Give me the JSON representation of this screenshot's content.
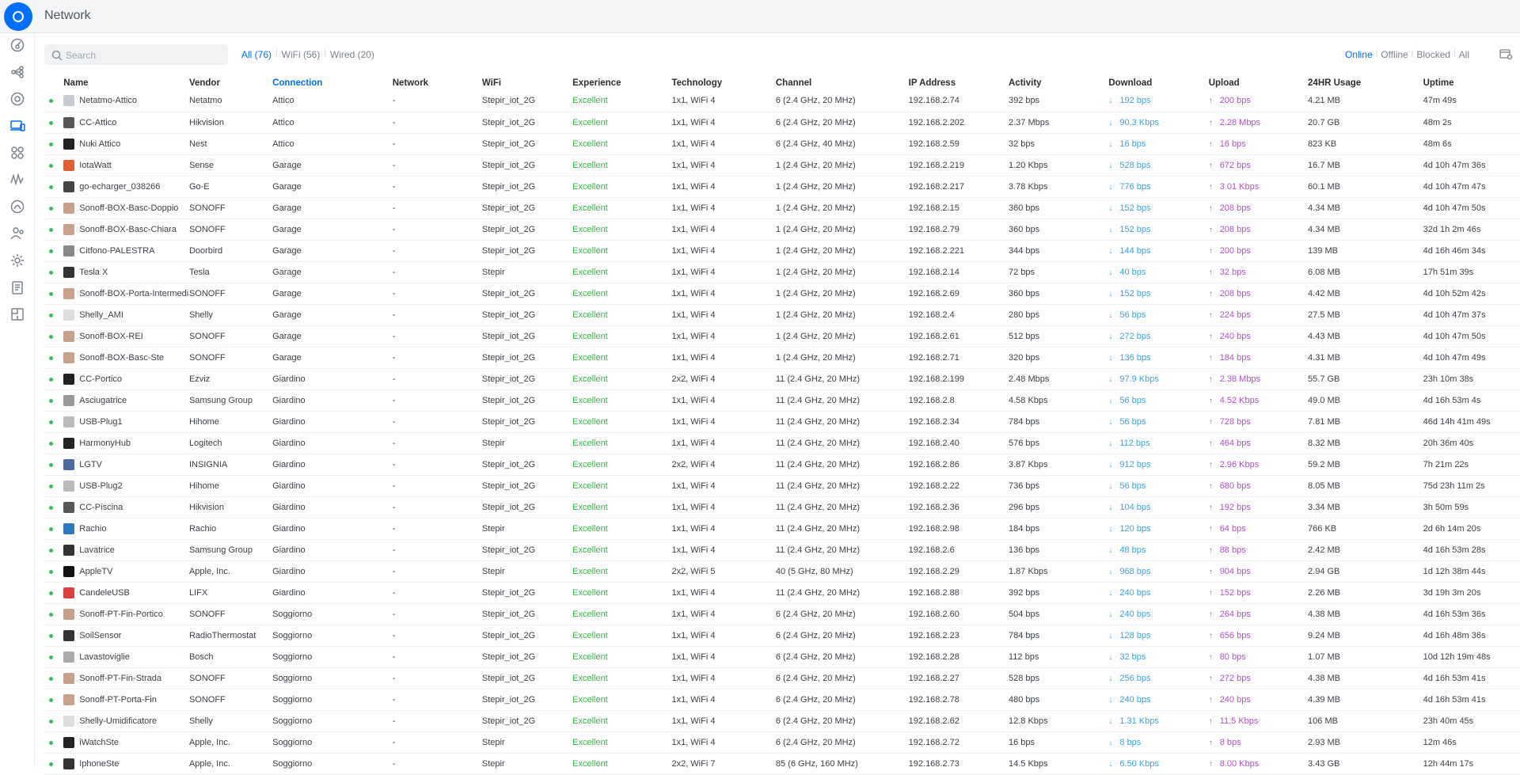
{
  "app": {
    "title": "Network"
  },
  "sidebar": {
    "items": [
      {
        "name": "dashboard-icon",
        "active": false
      },
      {
        "name": "topology-icon",
        "active": false
      },
      {
        "name": "devices-icon",
        "active": false
      },
      {
        "name": "clients-icon",
        "active": true
      },
      {
        "name": "statistics-icon",
        "active": false
      },
      {
        "name": "insights-icon",
        "active": false
      },
      {
        "name": "hotspot-icon",
        "active": false
      },
      {
        "name": "users-icon",
        "active": false
      },
      {
        "name": "settings-icon",
        "active": false
      },
      {
        "name": "alerts-icon",
        "active": false
      },
      {
        "name": "map-icon",
        "active": false
      }
    ]
  },
  "toolbar": {
    "search_placeholder": "Search",
    "filters": [
      "All (76)",
      "WiFi (56)",
      "Wired (20)"
    ],
    "status_filters": [
      "Online",
      "Offline",
      "Blocked",
      "All"
    ]
  },
  "table": {
    "columns": [
      "Name",
      "Vendor",
      "Connection",
      "Network",
      "WiFi",
      "Experience",
      "Technology",
      "Channel",
      "IP Address",
      "Activity",
      "Download",
      "Upload",
      "24HR Usage",
      "Uptime"
    ],
    "sorted_column": "Connection",
    "rows": [
      [
        "Netatmo-Attico",
        "Netatmo",
        "Attico",
        "-",
        "Stepir_iot_2G",
        "Excellent",
        "1x1, WiFi 4",
        "6 (2.4 GHz, 20 MHz)",
        "192.168.2.74",
        "392 bps",
        "192 bps",
        "200 bps",
        "4.21 MB",
        "47m 49s"
      ],
      [
        "CC-Attico",
        "Hikvision",
        "Attico",
        "-",
        "Stepir_iot_2G",
        "Excellent",
        "1x1, WiFi 4",
        "6 (2.4 GHz, 20 MHz)",
        "192.168.2.202",
        "2.37 Mbps",
        "90.3 Kbps",
        "2.28 Mbps",
        "20.7 GB",
        "48m 2s"
      ],
      [
        "Nuki Attico",
        "Nest",
        "Attico",
        "-",
        "Stepir_iot_2G",
        "Excellent",
        "1x1, WiFi 4",
        "6 (2.4 GHz, 40 MHz)",
        "192.168.2.59",
        "32 bps",
        "16 bps",
        "16 bps",
        "823 KB",
        "48m 6s"
      ],
      [
        "IotaWatt",
        "Sense",
        "Garage",
        "-",
        "Stepir_iot_2G",
        "Excellent",
        "1x1, WiFi 4",
        "1 (2.4 GHz, 20 MHz)",
        "192.168.2.219",
        "1.20 Kbps",
        "528 bps",
        "672 bps",
        "16.7 MB",
        "4d 10h 47m 36s"
      ],
      [
        "go-echarger_038266",
        "Go-E",
        "Garage",
        "-",
        "Stepir_iot_2G",
        "Excellent",
        "1x1, WiFi 4",
        "1 (2.4 GHz, 20 MHz)",
        "192.168.2.217",
        "3.78 Kbps",
        "776 bps",
        "3.01 Kbps",
        "60.1 MB",
        "4d 10h 47m 47s"
      ],
      [
        "Sonoff-BOX-Basc-Doppio",
        "SONOFF",
        "Garage",
        "-",
        "Stepir_iot_2G",
        "Excellent",
        "1x1, WiFi 4",
        "1 (2.4 GHz, 20 MHz)",
        "192.168.2.15",
        "360 bps",
        "152 bps",
        "208 bps",
        "4.34 MB",
        "4d 10h 47m 50s"
      ],
      [
        "Sonoff-BOX-Basc-Chiara",
        "SONOFF",
        "Garage",
        "-",
        "Stepir_iot_2G",
        "Excellent",
        "1x1, WiFi 4",
        "1 (2.4 GHz, 20 MHz)",
        "192.168.2.79",
        "360 bps",
        "152 bps",
        "208 bps",
        "4.34 MB",
        "32d 1h 2m 46s"
      ],
      [
        "Citfono-PALESTRA",
        "Doorbird",
        "Garage",
        "-",
        "Stepir_iot_2G",
        "Excellent",
        "1x1, WiFi 4",
        "1 (2.4 GHz, 20 MHz)",
        "192.168.2.221",
        "344 bps",
        "144 bps",
        "200 bps",
        "139 MB",
        "4d 16h 46m 34s"
      ],
      [
        "Tesla X",
        "Tesla",
        "Garage",
        "-",
        "Stepir",
        "Excellent",
        "1x1, WiFi 4",
        "1 (2.4 GHz, 20 MHz)",
        "192.168.2.14",
        "72 bps",
        "40 bps",
        "32 bps",
        "6.08 MB",
        "17h 51m 39s"
      ],
      [
        "Sonoff-BOX-Porta-Intermedia",
        "SONOFF",
        "Garage",
        "-",
        "Stepir_iot_2G",
        "Excellent",
        "1x1, WiFi 4",
        "1 (2.4 GHz, 20 MHz)",
        "192.168.2.69",
        "360 bps",
        "152 bps",
        "208 bps",
        "4.42 MB",
        "4d 10h 52m 42s"
      ],
      [
        "Shelly_AMI",
        "Shelly",
        "Garage",
        "-",
        "Stepir_iot_2G",
        "Excellent",
        "1x1, WiFi 4",
        "1 (2.4 GHz, 20 MHz)",
        "192.168.2.4",
        "280 bps",
        "56 bps",
        "224 bps",
        "27.5 MB",
        "4d 10h 47m 37s"
      ],
      [
        "Sonoff-BOX-REI",
        "SONOFF",
        "Garage",
        "-",
        "Stepir_iot_2G",
        "Excellent",
        "1x1, WiFi 4",
        "1 (2.4 GHz, 20 MHz)",
        "192.168.2.61",
        "512 bps",
        "272 bps",
        "240 bps",
        "4.43 MB",
        "4d 10h 47m 50s"
      ],
      [
        "Sonoff-BOX-Basc-Ste",
        "SONOFF",
        "Garage",
        "-",
        "Stepir_iot_2G",
        "Excellent",
        "1x1, WiFi 4",
        "1 (2.4 GHz, 20 MHz)",
        "192.168.2.71",
        "320 bps",
        "136 bps",
        "184 bps",
        "4.31 MB",
        "4d 10h 47m 49s"
      ],
      [
        "CC-Portico",
        "Ezviz",
        "Giardino",
        "-",
        "Stepir_iot_2G",
        "Excellent",
        "2x2, WiFi 4",
        "11 (2.4 GHz, 20 MHz)",
        "192.168.2.199",
        "2.48 Mbps",
        "97.9 Kbps",
        "2.38 Mbps",
        "55.7 GB",
        "23h 10m 38s"
      ],
      [
        "Asciugatrice",
        "Samsung Group",
        "Giardino",
        "-",
        "Stepir_iot_2G",
        "Excellent",
        "1x1, WiFi 4",
        "11 (2.4 GHz, 20 MHz)",
        "192.168.2.8",
        "4.58 Kbps",
        "56 bps",
        "4.52 Kbps",
        "49.0 MB",
        "4d 16h 53m 4s"
      ],
      [
        "USB-Plug1",
        "Hihome",
        "Giardino",
        "-",
        "Stepir_iot_2G",
        "Excellent",
        "1x1, WiFi 4",
        "11 (2.4 GHz, 20 MHz)",
        "192.168.2.34",
        "784 bps",
        "56 bps",
        "728 bps",
        "7.81 MB",
        "46d 14h 41m 49s"
      ],
      [
        "HarmonyHub",
        "Logitech",
        "Giardino",
        "-",
        "Stepir",
        "Excellent",
        "1x1, WiFi 4",
        "11 (2.4 GHz, 20 MHz)",
        "192.168.2.40",
        "576 bps",
        "112 bps",
        "464 bps",
        "8.32 MB",
        "20h 36m 40s"
      ],
      [
        "LGTV",
        "INSIGNIA",
        "Giardino",
        "-",
        "Stepir_iot_2G",
        "Excellent",
        "2x2, WiFi 4",
        "11 (2.4 GHz, 20 MHz)",
        "192.168.2.86",
        "3.87 Kbps",
        "912 bps",
        "2.96 Kbps",
        "59.2 MB",
        "7h 21m 22s"
      ],
      [
        "USB-Plug2",
        "Hihome",
        "Giardino",
        "-",
        "Stepir_iot_2G",
        "Excellent",
        "1x1, WiFi 4",
        "11 (2.4 GHz, 20 MHz)",
        "192.168.2.22",
        "736 bps",
        "56 bps",
        "680 bps",
        "8.05 MB",
        "75d 23h 11m 2s"
      ],
      [
        "CC-Piscina",
        "Hikvision",
        "Giardino",
        "-",
        "Stepir_iot_2G",
        "Excellent",
        "1x1, WiFi 4",
        "11 (2.4 GHz, 20 MHz)",
        "192.168.2.36",
        "296 bps",
        "104 bps",
        "192 bps",
        "3.34 MB",
        "3h 50m 59s"
      ],
      [
        "Rachio",
        "Rachio",
        "Giardino",
        "-",
        "Stepir",
        "Excellent",
        "1x1, WiFi 4",
        "11 (2.4 GHz, 20 MHz)",
        "192.168.2.98",
        "184 bps",
        "120 bps",
        "64 bps",
        "766 KB",
        "2d 6h 14m 20s"
      ],
      [
        "Lavatrice",
        "Samsung Group",
        "Giardino",
        "-",
        "Stepir_iot_2G",
        "Excellent",
        "1x1, WiFi 4",
        "11 (2.4 GHz, 20 MHz)",
        "192.168.2.6",
        "136 bps",
        "48 bps",
        "88 bps",
        "2.42 MB",
        "4d 16h 53m 28s"
      ],
      [
        "AppleTV",
        "Apple, Inc.",
        "Giardino",
        "-",
        "Stepir",
        "Excellent",
        "2x2, WiFi 5",
        "40 (5 GHz, 80 MHz)",
        "192.168.2.29",
        "1.87 Kbps",
        "968 bps",
        "904 bps",
        "2.94 GB",
        "1d 12h 38m 44s"
      ],
      [
        "CandeleUSB",
        "LIFX",
        "Giardino",
        "-",
        "Stepir_iot_2G",
        "Excellent",
        "1x1, WiFi 4",
        "11 (2.4 GHz, 20 MHz)",
        "192.168.2.88",
        "392 bps",
        "240 bps",
        "152 bps",
        "2.26 MB",
        "3d 19h 3m 20s"
      ],
      [
        "Sonoff-PT-Fin-Portico",
        "SONOFF",
        "Soggiorno",
        "-",
        "Stepir_iot_2G",
        "Excellent",
        "1x1, WiFi 4",
        "6 (2.4 GHz, 20 MHz)",
        "192.168.2.60",
        "504 bps",
        "240 bps",
        "264 bps",
        "4.38 MB",
        "4d 16h 53m 36s"
      ],
      [
        "SoilSensor",
        "RadioThermostat",
        "Soggiorno",
        "-",
        "Stepir_iot_2G",
        "Excellent",
        "1x1, WiFi 4",
        "6 (2.4 GHz, 20 MHz)",
        "192.168.2.23",
        "784 bps",
        "128 bps",
        "656 bps",
        "9.24 MB",
        "4d 16h 48m 36s"
      ],
      [
        "Lavastoviglie",
        "Bosch",
        "Soggiorno",
        "-",
        "Stepir_iot_2G",
        "Excellent",
        "1x1, WiFi 4",
        "6 (2.4 GHz, 20 MHz)",
        "192.168.2.28",
        "112 bps",
        "32 bps",
        "80 bps",
        "1.07 MB",
        "10d 12h 19m 48s"
      ],
      [
        "Sonoff-PT-Fin-Strada",
        "SONOFF",
        "Soggiorno",
        "-",
        "Stepir_iot_2G",
        "Excellent",
        "1x1, WiFi 4",
        "6 (2.4 GHz, 20 MHz)",
        "192.168.2.27",
        "528 bps",
        "256 bps",
        "272 bps",
        "4.38 MB",
        "4d 16h 53m 41s"
      ],
      [
        "Sonoff-PT-Porta-Fin",
        "SONOFF",
        "Soggiorno",
        "-",
        "Stepir_iot_2G",
        "Excellent",
        "1x1, WiFi 4",
        "6 (2.4 GHz, 20 MHz)",
        "192.168.2.78",
        "480 bps",
        "240 bps",
        "240 bps",
        "4.39 MB",
        "4d 16h 53m 41s"
      ],
      [
        "Shelly-Umidificatore",
        "Shelly",
        "Soggiorno",
        "-",
        "Stepir_iot_2G",
        "Excellent",
        "1x1, WiFi 4",
        "6 (2.4 GHz, 20 MHz)",
        "192.168.2.62",
        "12.8 Kbps",
        "1.31 Kbps",
        "11.5 Kbps",
        "106 MB",
        "23h 40m 45s"
      ],
      [
        "iWatchSte",
        "Apple, Inc.",
        "Soggiorno",
        "-",
        "Stepir",
        "Excellent",
        "1x1, WiFi 4",
        "6 (2.4 GHz, 20 MHz)",
        "192.168.2.72",
        "16 bps",
        "8 bps",
        "8 bps",
        "2.93 MB",
        "12m 46s"
      ],
      [
        "IphoneSte",
        "Apple, Inc.",
        "Soggiorno",
        "-",
        "Stepir",
        "Excellent",
        "2x2, WiFi 7",
        "85 (6 GHz, 160 MHz)",
        "192.168.2.73",
        "14.5 Kbps",
        "6.50 Kbps",
        "8.00 Kbps",
        "3.43 GB",
        "12h 44m 17s"
      ]
    ],
    "row_icons": [
      "device-netatmo-icon",
      "camera-icon",
      "lock-icon",
      "sensor-icon",
      "charger-icon",
      "sonoff-box-icon",
      "sonoff-box-icon",
      "doorbell-icon",
      "car-icon",
      "sonoff-box-icon",
      "shelly-icon",
      "sonoff-box-icon",
      "sonoff-box-icon",
      "camera-dome-icon",
      "dryer-icon",
      "plug-icon",
      "hub-icon",
      "tv-icon",
      "plug-icon",
      "camera-icon",
      "sprinkler-icon",
      "washer-icon",
      "appletv-icon",
      "lamp-icon",
      "sonoff-box-icon",
      "soil-sensor-icon",
      "dishwasher-icon",
      "sonoff-box-icon",
      "sonoff-box-icon",
      "shelly-icon",
      "watch-icon",
      "phone-icon"
    ]
  },
  "colors": {
    "accent": "#006fff",
    "experience": "#39b54a",
    "download": "#3aa3e3",
    "upload": "#b24fd1",
    "online_dot": "#36c05a"
  }
}
